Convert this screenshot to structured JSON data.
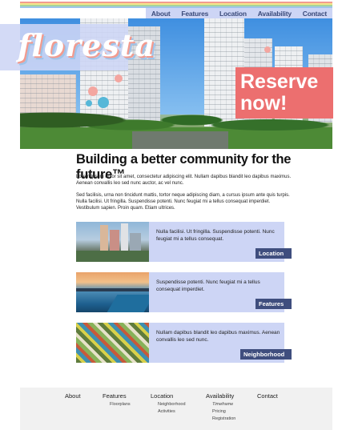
{
  "brand": {
    "logo_text": "floresta",
    "colors": {
      "nav_bg": "#cdd5f5",
      "accent": "#ec6f6f",
      "button_bg": "#3f4e7e",
      "stripe_1": "#f29b8f",
      "stripe_2": "#f6e48a",
      "stripe_3": "#a6d59a",
      "stripe_4": "#9fc4ea"
    }
  },
  "nav": {
    "items": [
      {
        "label": "About"
      },
      {
        "label": "Features"
      },
      {
        "label": "Location"
      },
      {
        "label": "Availability"
      },
      {
        "label": "Contact"
      }
    ]
  },
  "hero": {
    "reserve_label": "Reserve now!"
  },
  "intro": {
    "headline": "Building a better community for the future™",
    "paragraph_1": "Lorem ipsum dolor sit amet, consectetur adipiscing elit. Nullam dapibus blandit leo dapibus maximus. Aenean convallis leo sed nunc auctor, ac vel nunc.",
    "paragraph_2": "Sed facilisis, urna non tincidunt mattis, tortor neque adipiscing diam, a cursus ipsum ante quis turpis. Nulla facilisi. Ut fringilla. Suspendisse potenti. Nunc feugiat mi a tellus consequat imperdiet. Vestibulum sapien. Proin quam. Etiam ultrices."
  },
  "cards": [
    {
      "text": "Nulla facilisi. Ut fringilla. Suspendisse potenti. Nunc feugiat mi a tellus consequat.",
      "button": "Location"
    },
    {
      "text": "Suspendisse potenti. Nunc feugiat mi a tellus consequat imperdiet.",
      "button": "Features"
    },
    {
      "text": "Nullam dapibus blandit leo dapibus maximus. Aenean convallis leo sed nunc.",
      "button": "Neighborhood"
    }
  ],
  "footer": {
    "columns": [
      {
        "heading": "About",
        "links": []
      },
      {
        "heading": "Features",
        "links": [
          "Floorplans"
        ]
      },
      {
        "heading": "Location",
        "links": [
          "Neighborhood",
          "Activities"
        ]
      },
      {
        "heading": "Availability",
        "links": [
          "Timeframe",
          "Pricing",
          "Registration"
        ]
      },
      {
        "heading": "Contact",
        "links": []
      }
    ]
  }
}
